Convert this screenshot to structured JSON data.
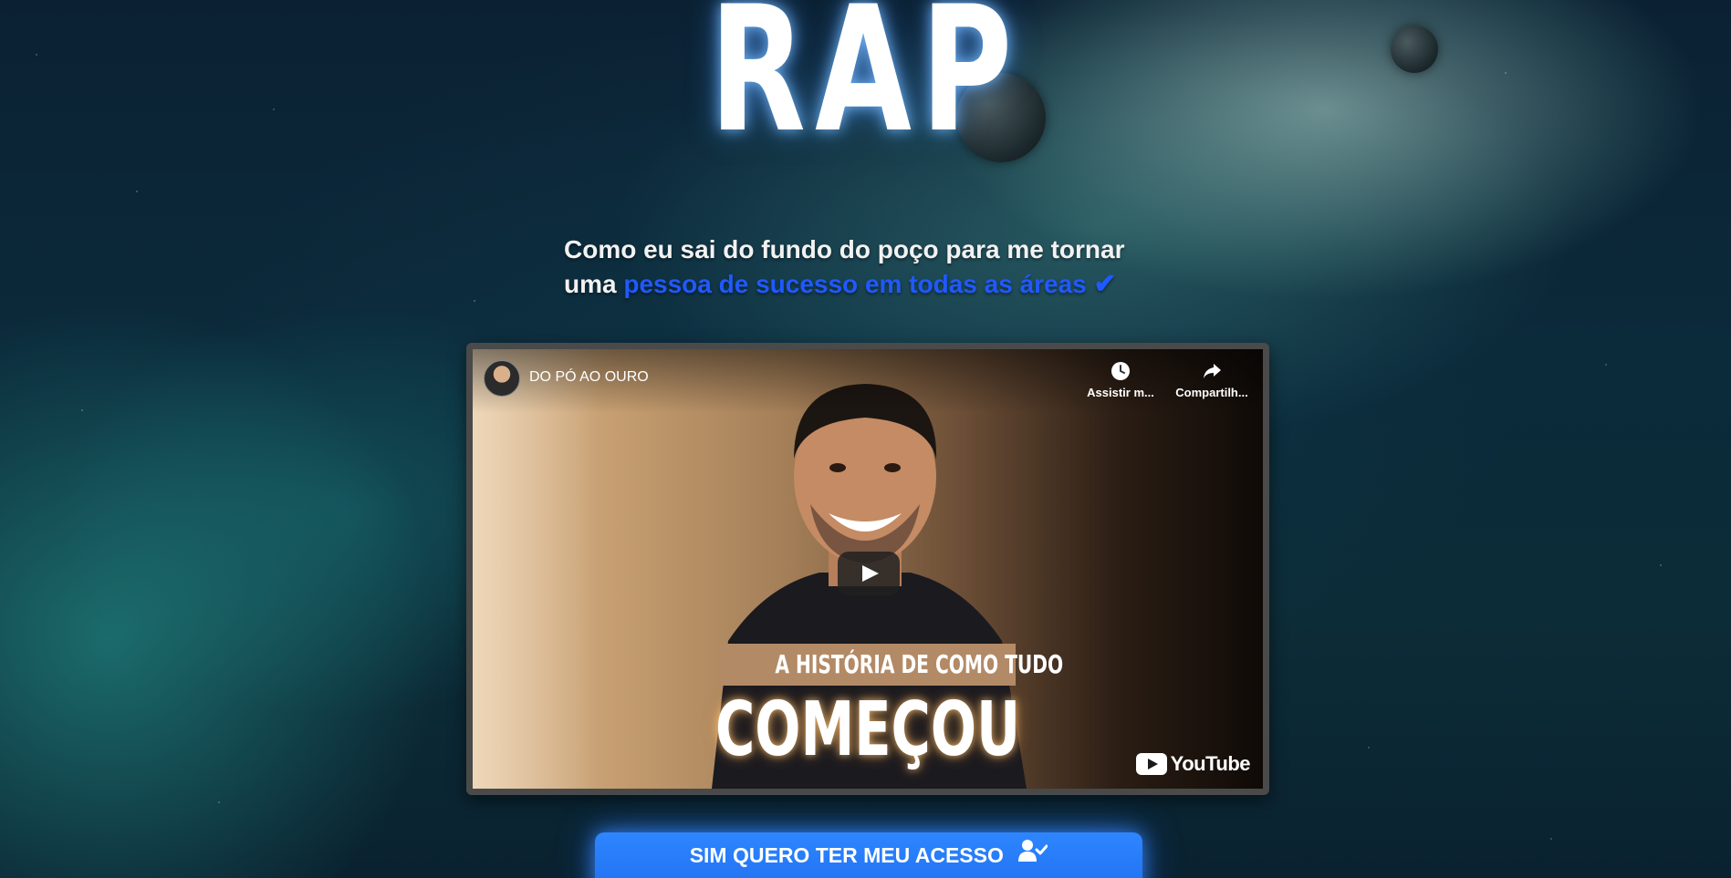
{
  "hero": {
    "title": "RAP"
  },
  "headline": {
    "line1": "Como eu sai do fundo do poço para me tornar",
    "line2_prefix": "uma",
    "line2_highlight": "pessoa de sucesso em todas as áreas",
    "check_icon": "check-icon"
  },
  "video": {
    "channel_name": "DO PÓ AO OURO",
    "watch_later_label": "Assistir m...",
    "share_label": "Compartilh...",
    "caption_top": "A HISTÓRIA DE COMO TUDO",
    "caption_main": "COMEÇOU",
    "platform_logo_text": "YouTube"
  },
  "cta": {
    "label": "SIM QUERO TER MEU ACESSO",
    "icon": "user-check-icon"
  },
  "colors": {
    "accent_blue": "#1f59ff",
    "cta_blue": "#2e86ff",
    "caption_box": "#b38a66"
  }
}
